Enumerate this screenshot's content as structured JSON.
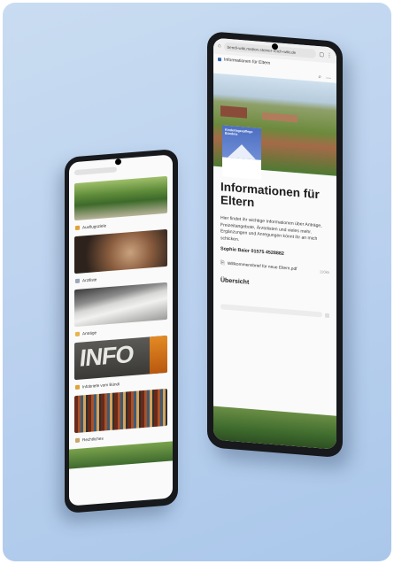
{
  "phone_left": {
    "tiles": [
      {
        "label": "Ausflugsziele",
        "icon": "folder-icon",
        "icon_color": "#e0a23a"
      },
      {
        "label": "Arztliste",
        "icon": "document-icon",
        "icon_color": "#9aa8b8"
      },
      {
        "label": "Anträge",
        "icon": "pencil-icon",
        "icon_color": "#e9b44c"
      },
      {
        "label": "Infobriefe vom Bündi",
        "icon": "mail-icon",
        "icon_color": "#e0a23a"
      },
      {
        "label": "Rechtliches",
        "icon": "scale-icon",
        "icon_color": "#c9a66b"
      }
    ]
  },
  "phone_right": {
    "url": "bendi-wiki.mation.steiner-reich-wiki.de",
    "tab_title": "Informationen für Eltern",
    "badge_text": "Kindertagespflege Bündnis",
    "title": "Informationen für Eltern",
    "paragraph": "Hier findet ihr wichtige Informationen über Anträge, Freizeitangebote, Ärztelisten und vieles mehr. Ergänzungen und Anregungen könnt ihr an mich schicken.",
    "contact": "Sophie Baier 01575 4528882",
    "file_name": "Willkommensbrief für neue Eltern.pdf",
    "file_size": "110kb",
    "section_title": "Übersicht"
  },
  "colors": {
    "background_gradient": [
      "#c9dcf1",
      "#aac7ea"
    ],
    "phone_frame": "#17191c",
    "accent_blue": "#4e6fc2"
  }
}
